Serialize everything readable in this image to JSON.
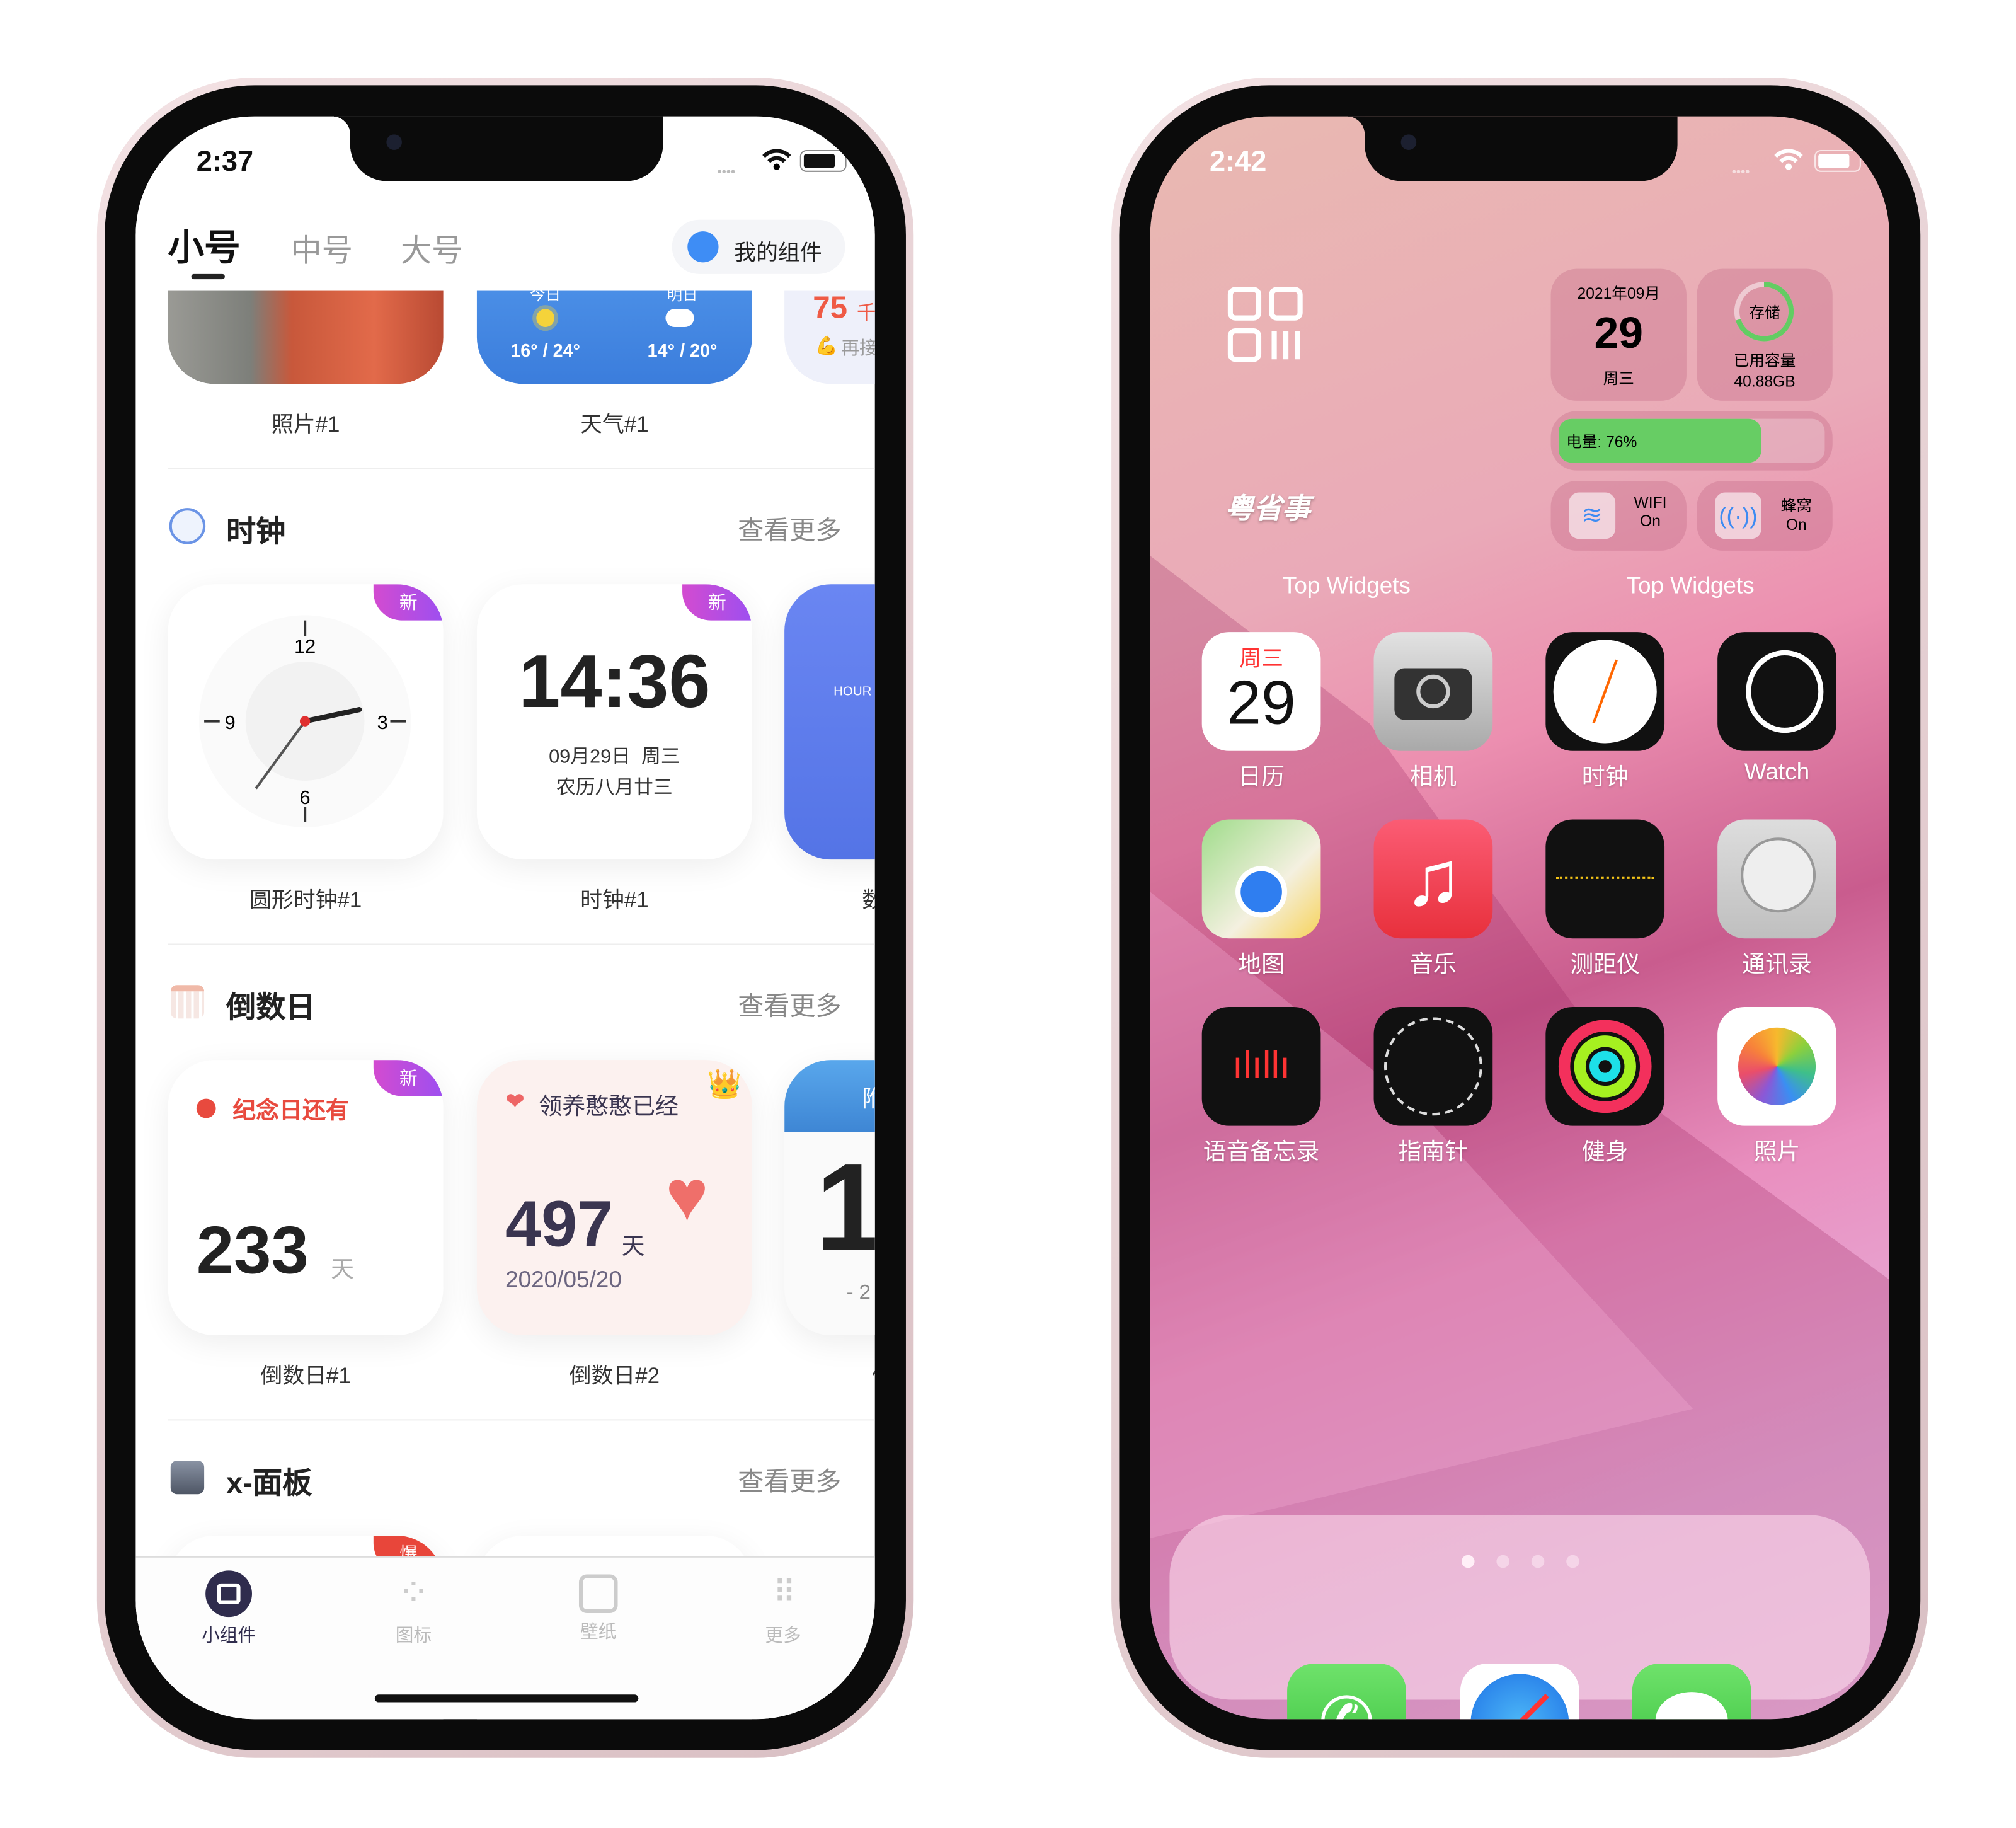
{
  "left_phone": {
    "status": {
      "time": "2:37"
    },
    "header": {
      "tabs": [
        {
          "label": "小号",
          "active": true
        },
        {
          "label": "中号"
        },
        {
          "label": "大号"
        }
      ],
      "my_widgets": "我的组件"
    },
    "top_row": {
      "photo_label": "照片#1",
      "weather": {
        "today_label": "今日",
        "tomorrow_label": "明日",
        "today_temp": "16° / 24°",
        "tomorrow_temp": "14° / 20°",
        "label": "天气#1"
      },
      "steps": {
        "value": "75",
        "unit": "千",
        "text": "再接"
      }
    },
    "sections": {
      "clock": {
        "title": "时钟",
        "more": "查看更多",
        "round_clock": {
          "badge": "新",
          "numbers": [
            "12",
            "3",
            "6",
            "9"
          ],
          "label": "圆形时钟#1"
        },
        "digital_clock": {
          "badge": "新",
          "time": "14:36",
          "date": "09月29日  周三",
          "lunar": "农历八月廿三",
          "label": "时钟#1"
        },
        "third": {
          "hour_label": "HOUR",
          "label": "数"
        }
      },
      "countdown": {
        "title": "倒数日",
        "more": "查看更多",
        "card1": {
          "badge": "新",
          "title": "纪念日还有",
          "days": "233",
          "unit": "天",
          "label": "倒数日#1"
        },
        "card2": {
          "title": "领养憨憨已经",
          "days": "497",
          "unit": "天",
          "date": "2020/05/20",
          "label": "倒数日#2"
        },
        "card3": {
          "head": "附",
          "days": "1",
          "sub": "- 2",
          "label": "倒"
        }
      },
      "xpanel": {
        "title": "x-面板",
        "more": "查看更多",
        "badge": "爆"
      }
    },
    "tabbar": [
      {
        "label": "小组件",
        "active": true
      },
      {
        "label": "图标"
      },
      {
        "label": "壁纸"
      },
      {
        "label": "更多"
      }
    ]
  },
  "right_phone": {
    "status": {
      "time": "2:42"
    },
    "app_name_widget": "粤省事",
    "date_widget": {
      "year_month": "2021年09月",
      "day": "29",
      "weekday": "周三"
    },
    "storage_widget": {
      "title": "存储",
      "used_label": "已用容量",
      "used": "40.88GB",
      "fraction": 0.7
    },
    "battery_widget": {
      "text": "电量: 76%",
      "percent": 76
    },
    "wifi_widget": {
      "name": "WIFI",
      "state": "On"
    },
    "cell_widget": {
      "name": "蜂窝",
      "state": "On"
    },
    "widget_captions": [
      "Top Widgets",
      "Top Widgets"
    ],
    "apps": [
      {
        "name": "日历",
        "icon": "calendar-icon",
        "weekday": "周三",
        "day": "29"
      },
      {
        "name": "相机",
        "icon": "camera-icon"
      },
      {
        "name": "时钟",
        "icon": "clock-icon"
      },
      {
        "name": "Watch",
        "icon": "watch-icon"
      },
      {
        "name": "地图",
        "icon": "maps-icon"
      },
      {
        "name": "音乐",
        "icon": "music-icon"
      },
      {
        "name": "测距仪",
        "icon": "measure-icon"
      },
      {
        "name": "通讯录",
        "icon": "contacts-icon"
      },
      {
        "name": "语音备忘录",
        "icon": "voice-memos-icon"
      },
      {
        "name": "指南针",
        "icon": "compass-icon"
      },
      {
        "name": "健身",
        "icon": "fitness-icon"
      },
      {
        "name": "照片",
        "icon": "photos-icon"
      }
    ],
    "page_dots": {
      "count": 4,
      "active": 0
    },
    "dock": [
      {
        "icon": "phone-icon"
      },
      {
        "icon": "safari-icon"
      },
      {
        "icon": "messages-icon"
      }
    ]
  }
}
